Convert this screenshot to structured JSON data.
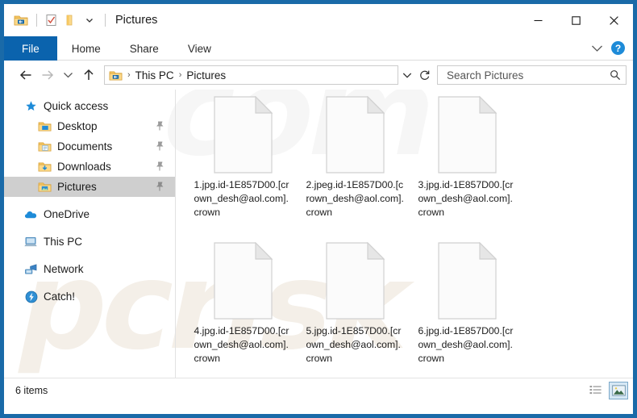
{
  "window": {
    "title": "Pictures",
    "accent_color": "#1a6aa8",
    "file_tab_color": "#0b63ad",
    "quick_access_toolbar": [
      {
        "name": "explorer-icon",
        "label": "Pictures folder"
      },
      {
        "name": "properties-icon",
        "label": "Properties"
      },
      {
        "name": "new-folder-icon",
        "label": "New folder"
      },
      {
        "name": "customize-qat-icon",
        "label": "Customize Quick Access Toolbar"
      }
    ],
    "controls": {
      "minimize": "—",
      "maximize": "□",
      "close": "✕"
    }
  },
  "ribbon": {
    "tabs": [
      {
        "label": "File",
        "active": true
      },
      {
        "label": "Home",
        "active": false
      },
      {
        "label": "Share",
        "active": false
      },
      {
        "label": "View",
        "active": false
      }
    ],
    "collapse_icon": "chevron-down-icon",
    "help_label": "?"
  },
  "navigation": {
    "back_label": "Back",
    "forward_label": "Forward",
    "recent_label": "Recent locations",
    "up_label": "Up",
    "breadcrumb": [
      "This PC",
      "Pictures"
    ],
    "breadcrumb_separator": "›",
    "refresh_label": "Refresh",
    "address_dropdown_label": "Previous locations"
  },
  "search": {
    "placeholder": "Search Pictures",
    "value": "",
    "icon": "search-icon"
  },
  "sidebar": {
    "items": [
      {
        "label": "Quick access",
        "icon": "star-icon",
        "indent": false,
        "pinned": false,
        "selected": false,
        "gap": false
      },
      {
        "label": "Desktop",
        "icon": "desktop-folder-icon",
        "indent": true,
        "pinned": true,
        "selected": false,
        "gap": false
      },
      {
        "label": "Documents",
        "icon": "documents-folder-icon",
        "indent": true,
        "pinned": true,
        "selected": false,
        "gap": false
      },
      {
        "label": "Downloads",
        "icon": "downloads-folder-icon",
        "indent": true,
        "pinned": true,
        "selected": false,
        "gap": false
      },
      {
        "label": "Pictures",
        "icon": "pictures-folder-icon",
        "indent": true,
        "pinned": true,
        "selected": true,
        "gap": false
      },
      {
        "label": "OneDrive",
        "icon": "onedrive-cloud-icon",
        "indent": false,
        "pinned": false,
        "selected": false,
        "gap": true
      },
      {
        "label": "This PC",
        "icon": "this-pc-icon",
        "indent": false,
        "pinned": false,
        "selected": false,
        "gap": true
      },
      {
        "label": "Network",
        "icon": "network-icon",
        "indent": false,
        "pinned": false,
        "selected": false,
        "gap": true
      },
      {
        "label": "Catch!",
        "icon": "catch-app-icon",
        "indent": false,
        "pinned": false,
        "selected": false,
        "gap": true
      }
    ]
  },
  "files": [
    {
      "name": "1.jpg.id-1E857D00.[crown_desh@aol.com].crown",
      "icon": "blank-document-icon"
    },
    {
      "name": "2.jpeg.id-1E857D00.[crown_desh@aol.com].crown",
      "icon": "blank-document-icon"
    },
    {
      "name": "3.jpg.id-1E857D00.[crown_desh@aol.com].crown",
      "icon": "blank-document-icon"
    },
    {
      "name": "4.jpg.id-1E857D00.[crown_desh@aol.com].crown",
      "icon": "blank-document-icon"
    },
    {
      "name": "5.jpg.id-1E857D00.[crown_desh@aol.com].crown",
      "icon": "blank-document-icon"
    },
    {
      "name": "6.jpg.id-1E857D00.[crown_desh@aol.com].crown",
      "icon": "blank-document-icon"
    }
  ],
  "statusbar": {
    "item_count_text": "6 items",
    "views": [
      {
        "name": "details-view-button",
        "label": "Details view",
        "active": false
      },
      {
        "name": "large-icons-view-button",
        "label": "Large icons view",
        "active": true
      }
    ]
  },
  "watermark": {
    "text": "pcrisk",
    "text2": "com"
  }
}
